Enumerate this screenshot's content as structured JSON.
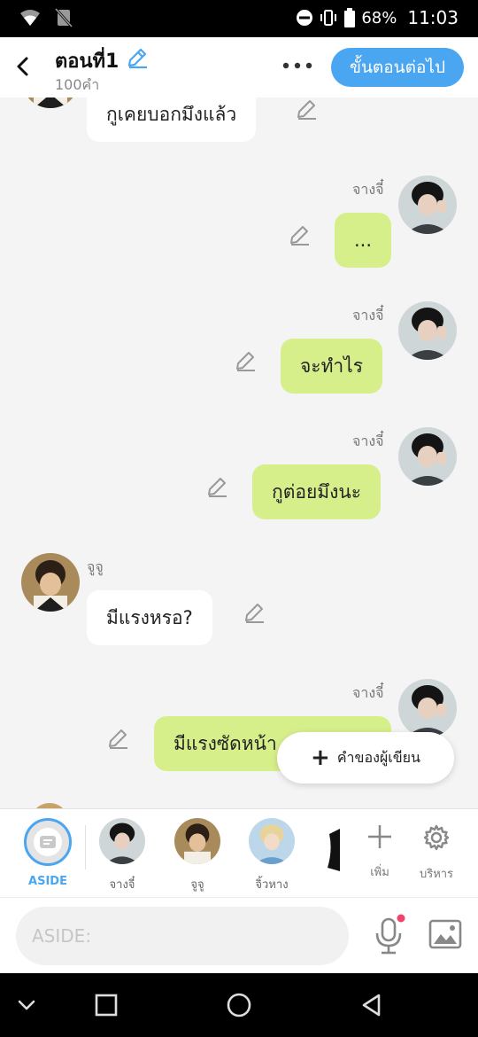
{
  "status": {
    "battery": "68%",
    "time": "11:03"
  },
  "header": {
    "title": "ตอนที่1",
    "word_count": "100คำ",
    "next_label": "ขั้นตอนต่อไป"
  },
  "messages": [
    {
      "side": "left",
      "text": "กูเคยบอกมึงแล้ว"
    },
    {
      "side": "right",
      "sender": "จางจี๋",
      "text": "..."
    },
    {
      "side": "right",
      "sender": "จางจี๋",
      "text": "จะทำไร"
    },
    {
      "side": "right",
      "sender": "จางจี๋",
      "text": "กูต่อยมึงนะ"
    },
    {
      "side": "left",
      "sender": "จูจู",
      "text": "มีแรงหรอ?"
    },
    {
      "side": "right",
      "sender": "จางจี๋",
      "text": "มีแรงซัดหน้า"
    }
  ],
  "fab": {
    "label": "คำของผู้เขียน"
  },
  "characters": {
    "aside_label": "ASIDE",
    "items": [
      {
        "name": "จางจี๋"
      },
      {
        "name": "จูจู"
      },
      {
        "name": "จิ้วหาง"
      }
    ],
    "add_label": "เพิ่ม",
    "manage_label": "บริหาร"
  },
  "input": {
    "placeholder": "ASIDE:"
  },
  "colors": {
    "accent": "#4aa6f0",
    "bubble_right": "#d7ef8b",
    "bubble_left": "#ffffff",
    "mic_dot": "#f0446a"
  }
}
